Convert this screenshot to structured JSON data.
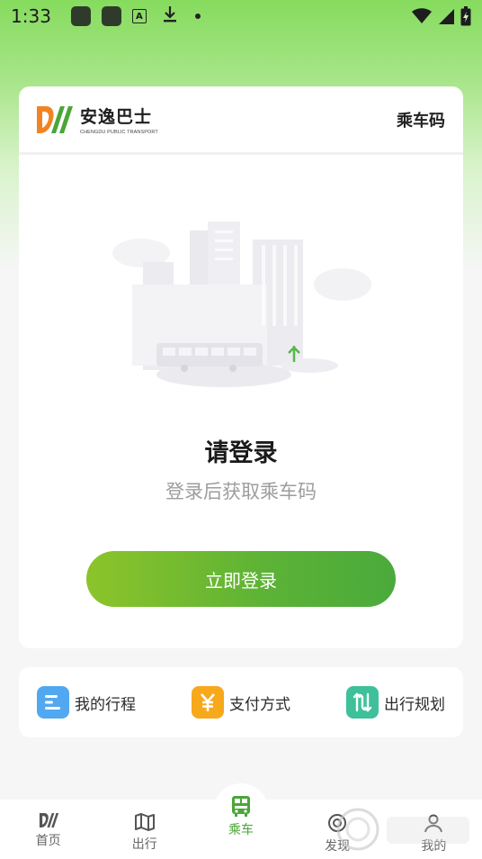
{
  "status_bar": {
    "time": "1:33",
    "icons": [
      "app-icon",
      "app-icon",
      "a-badge-icon",
      "download-icon",
      "dot-icon",
      "wifi-icon",
      "signal-icon",
      "battery-charging-icon"
    ],
    "a_letter": "A"
  },
  "header": {
    "brand_name": "安逸巴士",
    "brand_sub": "CHENGDU PUBLIC TRANSPORT",
    "title": "乘车码"
  },
  "login": {
    "title": "请登录",
    "subtitle": "登录后获取乘车码",
    "button_label": "立即登录"
  },
  "quick_actions": [
    {
      "label": "我的行程",
      "icon": "itinerary-icon",
      "color": "#52a8f0"
    },
    {
      "label": "支付方式",
      "icon": "yuan-icon",
      "color": "#f7a81b"
    },
    {
      "label": "出行规划",
      "icon": "route-icon",
      "color": "#3ec19a"
    }
  ],
  "bottom_nav": [
    {
      "label": "首页",
      "icon": "home-logo-icon",
      "active": false
    },
    {
      "label": "出行",
      "icon": "map-icon",
      "active": false
    },
    {
      "label": "乘车",
      "icon": "bus-qr-icon",
      "active": true
    },
    {
      "label": "发现",
      "icon": "discover-icon",
      "active": false
    },
    {
      "label": "我的",
      "icon": "profile-icon",
      "active": false
    }
  ],
  "colors": {
    "accent": "#4aa637",
    "button_start": "#8cc42a",
    "button_end": "#4aaa3b",
    "logo_orange": "#f08423",
    "logo_green": "#4aa637"
  }
}
